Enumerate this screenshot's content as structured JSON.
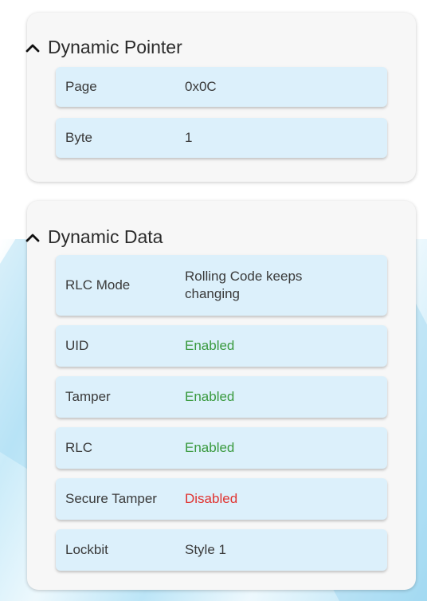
{
  "dynamic_pointer": {
    "title": "Dynamic Pointer",
    "rows": [
      {
        "label": "Page",
        "value": "0x0C"
      },
      {
        "label": "Byte",
        "value": "1"
      }
    ]
  },
  "dynamic_data": {
    "title": "Dynamic Data",
    "rows": [
      {
        "label": "RLC Mode",
        "value": "Rolling Code keeps changing"
      },
      {
        "label": "UID",
        "value": "Enabled",
        "status": "enabled"
      },
      {
        "label": "Tamper",
        "value": "Enabled",
        "status": "enabled"
      },
      {
        "label": "RLC",
        "value": "Enabled",
        "status": "enabled"
      },
      {
        "label": "Secure Tamper",
        "value": "Disabled",
        "status": "disabled"
      },
      {
        "label": "Lockbit",
        "value": "Style 1"
      }
    ]
  },
  "colors": {
    "enabled": "#3a9a3f",
    "disabled": "#e0322f",
    "row_background": "#dcf0fb",
    "card_background": "#f7f7f7"
  },
  "icons": {
    "collapse": "chevron-up-icon"
  }
}
